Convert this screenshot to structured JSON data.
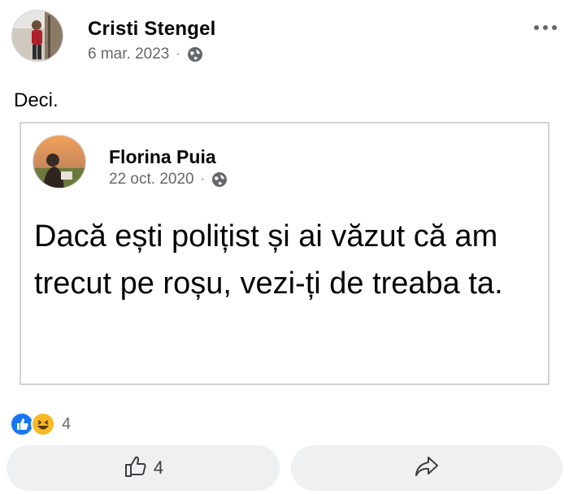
{
  "post": {
    "author": "Cristi Stengel",
    "date": "6 mar. 2023",
    "separator": "·",
    "text": "Deci.",
    "privacy_icon": "globe-icon"
  },
  "shared_post": {
    "author": "Florina Puia",
    "date": "22 oct. 2020",
    "separator": "·",
    "text": "Dacă ești polițist și ai văzut că am trecut pe roșu, vezi-ți de treaba ta.",
    "privacy_icon": "globe-icon"
  },
  "reactions": {
    "icons": [
      "like-reaction-icon",
      "haha-reaction-icon"
    ],
    "count": "4"
  },
  "actions": {
    "like_count": "4",
    "like_icon": "thumbs-up-icon",
    "share_icon": "share-arrow-icon"
  },
  "colors": {
    "like_blue": "#1877f2",
    "haha_yellow": "#f7b928",
    "secondary_text": "#65676b",
    "button_bg": "#eef0f2",
    "card_border": "#cfd2d6"
  }
}
